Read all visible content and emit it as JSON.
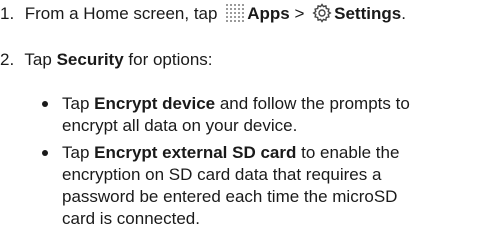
{
  "steps": [
    {
      "number": "1.",
      "prefix": "From a Home screen, tap",
      "apps_icon": "apps-grid-icon",
      "apps_label": "Apps",
      "separator": ">",
      "settings_icon": "settings-gear-icon",
      "settings_label": "Settings",
      "suffix": "."
    },
    {
      "number": "2.",
      "prefix": "Tap",
      "security_label": "Security",
      "suffix": "for options:"
    }
  ],
  "bullets": [
    {
      "prefix": "Tap",
      "bold": "Encrypt device",
      "line1_rest": "and follow the prompts to",
      "line2": "encrypt all data on your device."
    },
    {
      "prefix": "Tap",
      "bold": "Encrypt external SD card",
      "line1_rest": "to enable the",
      "line2": "encryption on SD card data that requires a",
      "line3": "password be entered each time the microSD",
      "line4": "card is connected."
    }
  ]
}
